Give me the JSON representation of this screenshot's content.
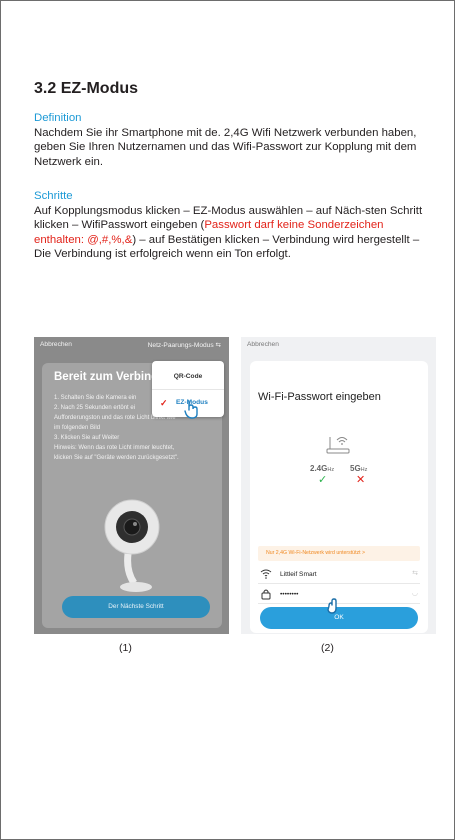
{
  "title": "3.2 EZ-Modus",
  "definition": {
    "heading": "Definition",
    "text": "Nachdem Sie ihr Smartphone mit de. 2,4G Wifi Netzwerk verbunden haben, geben Sie Ihren Nutzernamen und das Wifi-Passwort zur Kopplung mit dem Netzwerk ein."
  },
  "steps": {
    "heading": "Schritte",
    "text_before": "Auf Kopplungsmodus klicken – EZ-Modus auswählen – auf Näch-sten Schritt klicken – WifiPasswort eingeben (",
    "text_red": "Passwort darf keine Sonderzeichen enthalten: @,#,%,&",
    "text_after": ") – auf Bestätigen klicken – Verbindung wird hergestellt – Die Verbindung ist erfolgreich wenn ein Ton erfolgt."
  },
  "screenshot1": {
    "cancel": "Abbrechen",
    "pairing_mode": "Netz-Paarungs-Modus ⇆",
    "heading": "Bereit zum Verbind",
    "instructions": [
      "1. Schalten Sie die Kamera ein",
      "2. Nach 25 Sekunden ertönt ei",
      "Aufforderungston und das rote Licht blinkt wie",
      "im folgenden Bild",
      "3. Klicken Sie auf Weiter",
      "Hinweis: Wenn das rote Licht immer leuchtet,",
      "klicken Sie auf \"Geräte werden zurückgesetzt\"."
    ],
    "menu": {
      "qr": "QR-Code",
      "ez": "EZ-Modus",
      "check": "✓"
    },
    "next_button": "Der Nächste Schritt",
    "caption": "(1)"
  },
  "screenshot2": {
    "cancel": "Abbrechen",
    "heading": "Wi-Fi-Passwort eingeben",
    "band_24": "2.4G",
    "band_5": "5G",
    "band_unit": "Hz",
    "ok_mark": "✓",
    "no_mark": "✕",
    "warning": "Nur 2,4G Wi-Fi-Netzwerk wird unterstützt >",
    "ssid": "Littleif Smart",
    "password": "••••••••",
    "ok_button": "OK",
    "caption": "(2)"
  },
  "colors": {
    "accent": "#1d9ad6",
    "warning_red": "#e2231a",
    "button_blue": "#2a9fdc"
  }
}
